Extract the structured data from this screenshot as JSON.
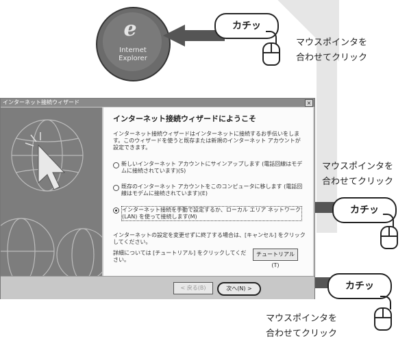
{
  "balloon_top": "カチッ",
  "balloon_middle": "カチッ",
  "balloon_bottom": "カチッ",
  "caption_top": [
    "マウスポインタを",
    "合わせてクリック"
  ],
  "caption_middle": [
    "マウスポインタを",
    "合わせてクリック"
  ],
  "caption_bottom": [
    "マウスポインタを",
    "合わせてクリック"
  ],
  "desktop_icon": {
    "label_line1": "Internet",
    "label_line2": "Explorer"
  },
  "wizard": {
    "window_title": "インターネット接続ウィザード",
    "close_glyph": "×",
    "heading": "インターネット接続ウィザードにようこそ",
    "intro": "インターネット接続ウィザードはインターネットに接続するお手伝いをします。このウィザードを使うと既存または新規のインターネット アカウントが設定できます。",
    "options": [
      {
        "text": "新しいインターネット アカウントにサインアップします (電話回線はモデムに接続されています)(S)",
        "selected": false
      },
      {
        "text": "既存のインターネット アカウントをこのコンピュータに移します (電話回線はモデムに接続されています)(E)",
        "selected": false
      },
      {
        "text": "インターネット接続を手動で設定するか、ローカル エリア ネットワーク (LAN) を使って接続します(M)",
        "selected": true
      }
    ],
    "cancel_note": "インターネットの設定を変更せずに終了する場合は、[キャンセル] をクリックしてください。",
    "tutorial_note": "詳細については [チュートリアル] をクリックしてください。",
    "tutorial_button": "チュートリアル(T)",
    "back_button": "< 戻る(B)",
    "next_button": "次へ(N) >"
  }
}
